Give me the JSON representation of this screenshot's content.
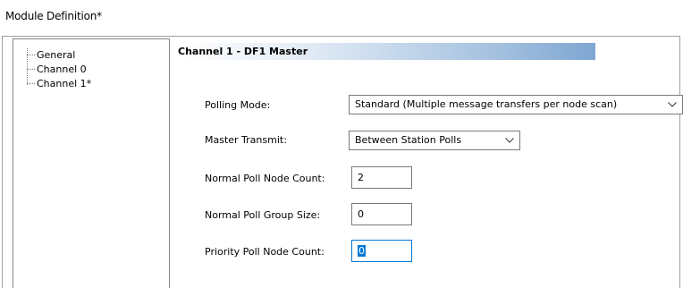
{
  "window": {
    "title": "Module Definition*"
  },
  "tree": {
    "items": [
      {
        "label": "General"
      },
      {
        "label": "Channel 0"
      },
      {
        "label": "Channel 1*"
      }
    ]
  },
  "section": {
    "title": "Channel 1 - DF1 Master"
  },
  "fields": {
    "polling_mode": {
      "label": "Polling Mode:",
      "value": "Standard (Multiple message transfers per node scan)"
    },
    "master_transmit": {
      "label": "Master Transmit:",
      "value": "Between Station Polls"
    },
    "normal_poll_node_count": {
      "label": "Normal Poll Node Count:",
      "value": "2"
    },
    "normal_poll_group_size": {
      "label": "Normal Poll Group Size:",
      "value": "0"
    },
    "priority_poll_node_count": {
      "label": "Priority Poll Node Count:",
      "value": "0"
    }
  },
  "colors": {
    "selection": "#0078d7",
    "header_gradient_end": "#7ea6d1"
  },
  "icons": {
    "dropdown": "chevron-down-icon"
  }
}
